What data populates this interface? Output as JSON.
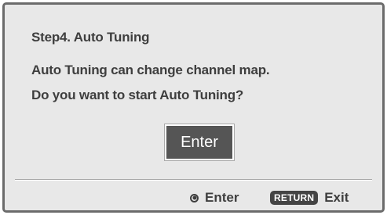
{
  "dialog": {
    "step_title": "Step4.  Auto Tuning",
    "message_line1": "Auto Tuning can change channel map.",
    "message_line2": "Do you want to start Auto Tuning?",
    "enter_button_label": "Enter"
  },
  "footer": {
    "enter_icon": "select-circle-icon",
    "enter_label": "Enter",
    "return_key_label": "RETURN",
    "exit_label": "Exit"
  },
  "colors": {
    "panel_background": "#e8e8e8",
    "border": "#6b6b6b",
    "text": "#3e3e3e",
    "button_background": "#555555"
  }
}
